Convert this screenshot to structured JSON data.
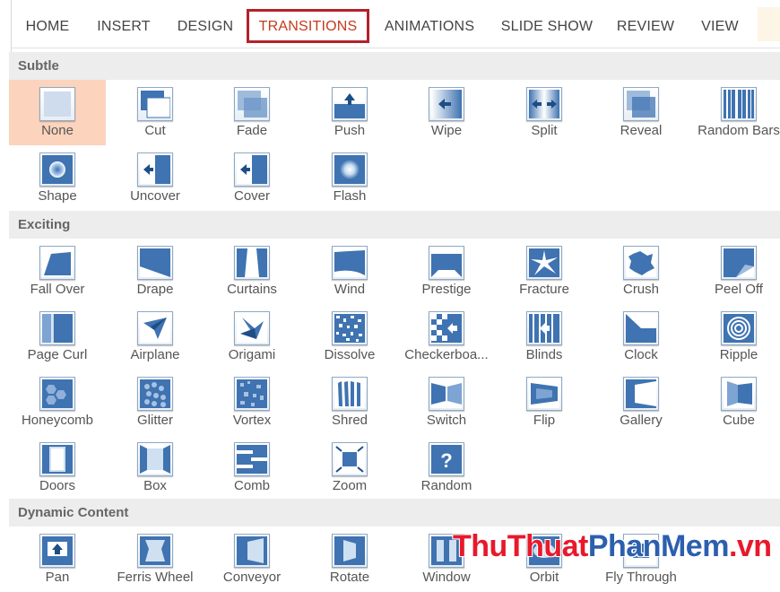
{
  "ribbon": {
    "tabs": [
      {
        "label": "HOME"
      },
      {
        "label": "INSERT"
      },
      {
        "label": "DESIGN"
      },
      {
        "label": "TRANSITIONS"
      },
      {
        "label": "ANIMATIONS"
      },
      {
        "label": "SLIDE SHOW"
      },
      {
        "label": "REVIEW"
      },
      {
        "label": "VIEW"
      }
    ],
    "active_tab": "TRANSITIONS"
  },
  "gallery": {
    "sections": [
      {
        "title": "Subtle",
        "items": [
          {
            "label": "None",
            "icon": "none-icon",
            "selected": true
          },
          {
            "label": "Cut",
            "icon": "cut-icon"
          },
          {
            "label": "Fade",
            "icon": "fade-icon"
          },
          {
            "label": "Push",
            "icon": "push-icon"
          },
          {
            "label": "Wipe",
            "icon": "wipe-icon"
          },
          {
            "label": "Split",
            "icon": "split-icon"
          },
          {
            "label": "Reveal",
            "icon": "reveal-icon"
          },
          {
            "label": "Random Bars",
            "icon": "random-bars-icon"
          },
          {
            "label": "Shape",
            "icon": "shape-icon"
          },
          {
            "label": "Uncover",
            "icon": "uncover-icon"
          },
          {
            "label": "Cover",
            "icon": "cover-icon"
          },
          {
            "label": "Flash",
            "icon": "flash-icon"
          }
        ]
      },
      {
        "title": "Exciting",
        "items": [
          {
            "label": "Fall Over",
            "icon": "fall-over-icon"
          },
          {
            "label": "Drape",
            "icon": "drape-icon"
          },
          {
            "label": "Curtains",
            "icon": "curtains-icon"
          },
          {
            "label": "Wind",
            "icon": "wind-icon"
          },
          {
            "label": "Prestige",
            "icon": "prestige-icon"
          },
          {
            "label": "Fracture",
            "icon": "fracture-icon"
          },
          {
            "label": "Crush",
            "icon": "crush-icon"
          },
          {
            "label": "Peel Off",
            "icon": "peel-off-icon"
          },
          {
            "label": "Page Curl",
            "icon": "page-curl-icon"
          },
          {
            "label": "Airplane",
            "icon": "airplane-icon"
          },
          {
            "label": "Origami",
            "icon": "origami-icon"
          },
          {
            "label": "Dissolve",
            "icon": "dissolve-icon"
          },
          {
            "label": "Checkerboa...",
            "icon": "checkerboard-icon"
          },
          {
            "label": "Blinds",
            "icon": "blinds-icon"
          },
          {
            "label": "Clock",
            "icon": "clock-icon"
          },
          {
            "label": "Ripple",
            "icon": "ripple-icon"
          },
          {
            "label": "Honeycomb",
            "icon": "honeycomb-icon"
          },
          {
            "label": "Glitter",
            "icon": "glitter-icon"
          },
          {
            "label": "Vortex",
            "icon": "vortex-icon"
          },
          {
            "label": "Shred",
            "icon": "shred-icon"
          },
          {
            "label": "Switch",
            "icon": "switch-icon"
          },
          {
            "label": "Flip",
            "icon": "flip-icon"
          },
          {
            "label": "Gallery",
            "icon": "gallery-icon"
          },
          {
            "label": "Cube",
            "icon": "cube-icon"
          },
          {
            "label": "Doors",
            "icon": "doors-icon"
          },
          {
            "label": "Box",
            "icon": "box-icon"
          },
          {
            "label": "Comb",
            "icon": "comb-icon"
          },
          {
            "label": "Zoom",
            "icon": "zoom-icon"
          },
          {
            "label": "Random",
            "icon": "random-icon"
          }
        ]
      },
      {
        "title": "Dynamic Content",
        "items": [
          {
            "label": "Pan",
            "icon": "pan-icon"
          },
          {
            "label": "Ferris Wheel",
            "icon": "ferris-wheel-icon"
          },
          {
            "label": "Conveyor",
            "icon": "conveyor-icon"
          },
          {
            "label": "Rotate",
            "icon": "rotate-icon"
          },
          {
            "label": "Window",
            "icon": "window-icon"
          },
          {
            "label": "Orbit",
            "icon": "orbit-icon"
          },
          {
            "label": "Fly Through",
            "icon": "fly-through-icon"
          }
        ]
      }
    ]
  },
  "watermark": {
    "part1": "ThuThuat",
    "part2": "PhanMem",
    "part3": ".vn"
  },
  "colors": {
    "accent": "#c43b1d",
    "tab_border": "#b3212b",
    "selected_bg": "#fcd3bc",
    "section_bg": "#ededed",
    "icon_blue": "#3f73b1",
    "watermark_red": "#e8192c",
    "watermark_blue": "#2c5fae"
  }
}
